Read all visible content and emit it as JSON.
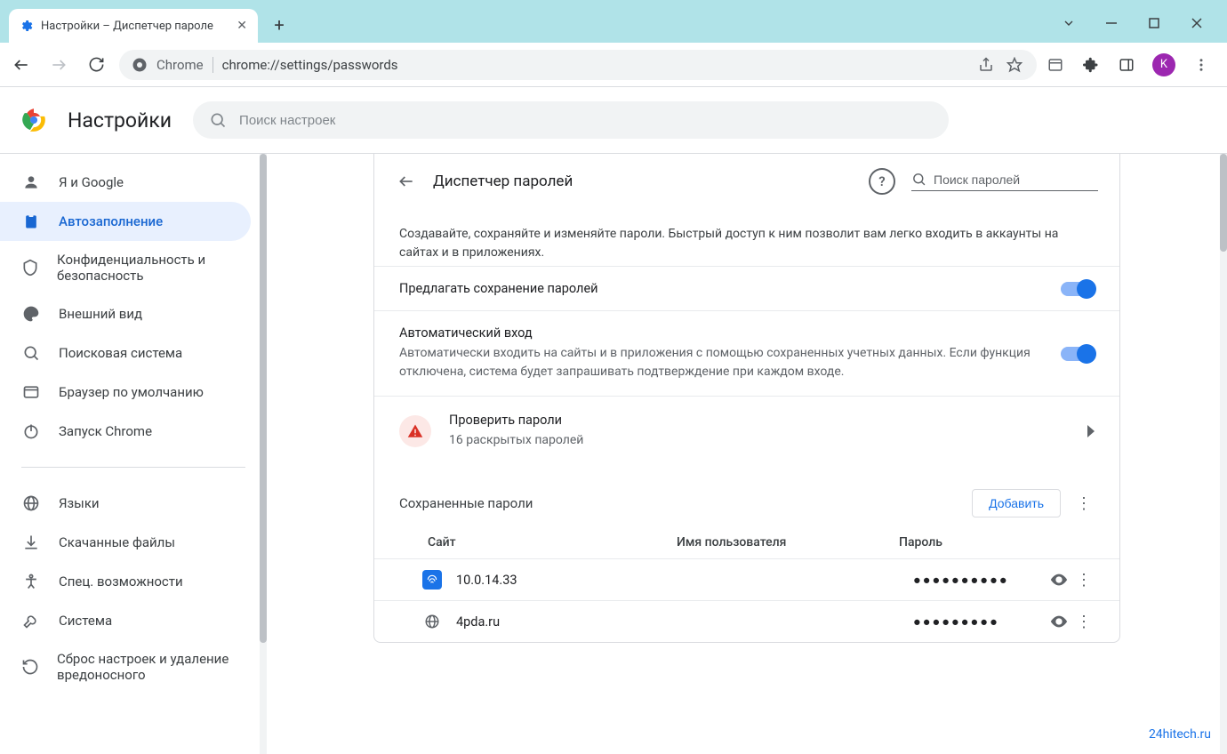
{
  "window": {
    "tab_title": "Настройки – Диспетчер пароле",
    "avatar_letter": "K"
  },
  "addressbar": {
    "app_label": "Chrome",
    "url": "chrome://settings/passwords"
  },
  "header": {
    "title": "Настройки",
    "search_placeholder": "Поиск настроек"
  },
  "sidebar": {
    "items": [
      {
        "label": "Я и Google"
      },
      {
        "label": "Автозаполнение"
      },
      {
        "label": "Конфиденциальность и безопасность"
      },
      {
        "label": "Внешний вид"
      },
      {
        "label": "Поисковая система"
      },
      {
        "label": "Браузер по умолчанию"
      },
      {
        "label": "Запуск Chrome"
      }
    ],
    "items2": [
      {
        "label": "Языки"
      },
      {
        "label": "Скачанные файлы"
      },
      {
        "label": "Спец. возможности"
      },
      {
        "label": "Система"
      },
      {
        "label": "Сброс настроек и удаление вредоносного"
      }
    ]
  },
  "main": {
    "card_title": "Диспетчер паролей",
    "pwd_search_placeholder": "Поиск паролей",
    "description": "Создавайте, сохраняйте и изменяйте пароли. Быстрый доступ к ним позволит вам легко входить в аккаунты на сайтах и в приложениях.",
    "offer_save": {
      "title": "Предлагать сохранение паролей"
    },
    "auto_signin": {
      "title": "Автоматический вход",
      "sub": "Автоматически входить на сайты и в приложения с помощью сохраненных учетных данных. Если функция отключена, система будет запрашивать подтверждение при каждом входе."
    },
    "check": {
      "title": "Проверить пароли",
      "sub": "16 раскрытых паролей"
    },
    "saved": {
      "title": "Сохраненные пароли",
      "add_label": "Добавить"
    },
    "columns": {
      "site": "Сайт",
      "user": "Имя пользователя",
      "pwd": "Пароль"
    },
    "rows": [
      {
        "site": "10.0.14.33",
        "user": "",
        "pwd": "●●●●●●●●●●"
      },
      {
        "site": "4pda.ru",
        "user": "",
        "pwd": "●●●●●●●●●"
      }
    ]
  },
  "watermark": "24hitech.ru"
}
